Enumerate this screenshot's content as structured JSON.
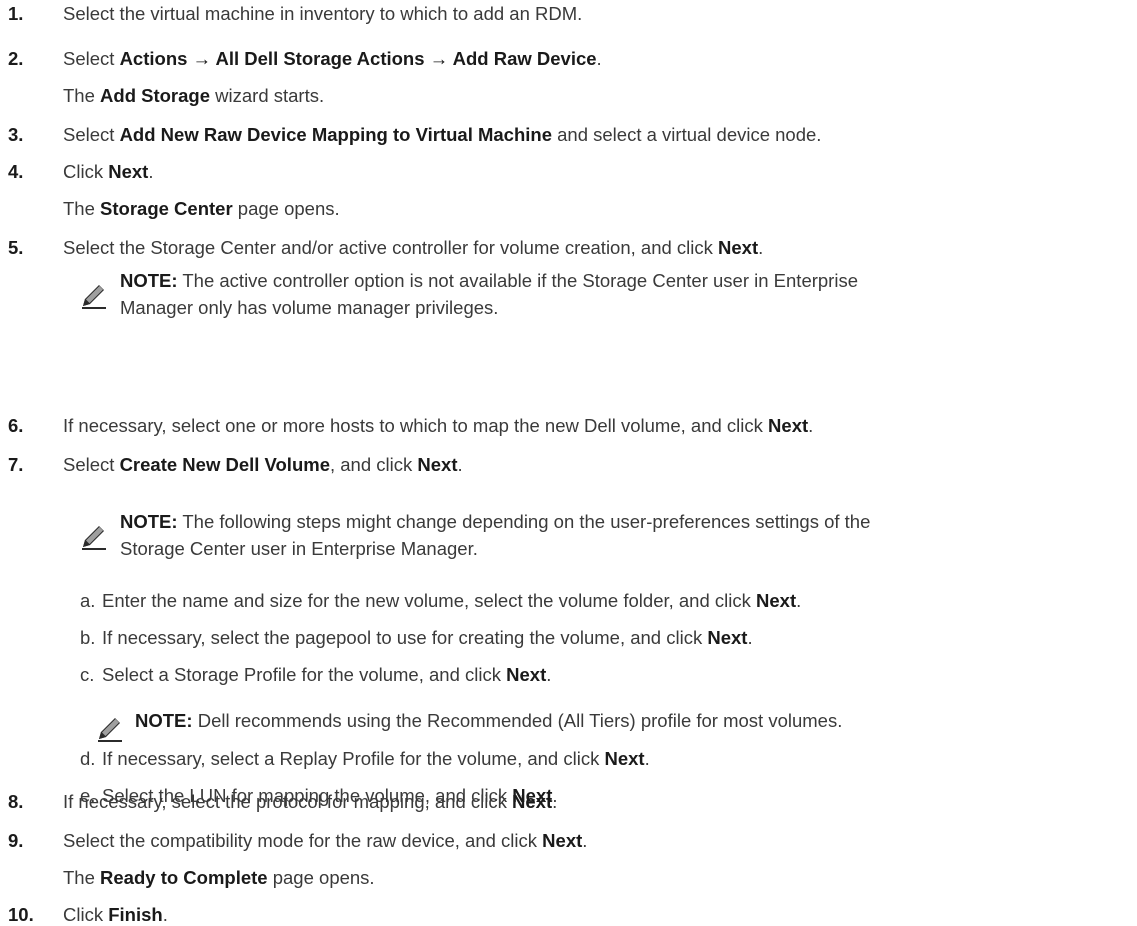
{
  "steps": [
    {
      "num": "1.",
      "segments": [
        {
          "t": "Select the virtual machine in inventory to which to add an RDM."
        }
      ]
    },
    {
      "num": "2.",
      "segments": [
        {
          "t": "Select "
        },
        {
          "t": "Actions → All Dell Storage Actions → Add Raw Device",
          "b": true
        },
        {
          "t": "."
        }
      ]
    },
    {
      "num": "",
      "segments": [
        {
          "t": "The "
        },
        {
          "t": "Add Storage",
          "b": true
        },
        {
          "t": " wizard starts."
        }
      ]
    },
    {
      "num": "3.",
      "segments": [
        {
          "t": "Select "
        },
        {
          "t": "Add New Raw Device Mapping to Virtual Machine",
          "b": true
        },
        {
          "t": " and select a virtual device node."
        }
      ]
    },
    {
      "num": "4.",
      "segments": [
        {
          "t": "Click "
        },
        {
          "t": "Next",
          "b": true
        },
        {
          "t": "."
        }
      ]
    },
    {
      "num": "",
      "segments": [
        {
          "t": "The "
        },
        {
          "t": "Storage Center",
          "b": true
        },
        {
          "t": " page opens."
        }
      ]
    },
    {
      "num": "5.",
      "segments": [
        {
          "t": "Select the Storage Center and/or active controller for volume creation, and click "
        },
        {
          "t": "Next",
          "b": true
        },
        {
          "t": "."
        }
      ]
    },
    {
      "num": "6.",
      "segments": [
        {
          "t": "If necessary, select one or more hosts to which to map the new Dell volume, and click "
        },
        {
          "t": "Next",
          "b": true
        },
        {
          "t": "."
        }
      ]
    },
    {
      "num": "7.",
      "segments": [
        {
          "t": "Select "
        },
        {
          "t": "Create New Dell Volume",
          "b": true
        },
        {
          "t": ", and click "
        },
        {
          "t": "Next",
          "b": true
        },
        {
          "t": "."
        }
      ]
    },
    {
      "num": "8.",
      "segments": [
        {
          "t": "If necessary, select the protocol for mapping, and click "
        },
        {
          "t": "Next",
          "b": true
        },
        {
          "t": "."
        }
      ]
    },
    {
      "num": "9.",
      "segments": [
        {
          "t": "Select the compatibility mode for the raw device, and click "
        },
        {
          "t": "Next",
          "b": true
        },
        {
          "t": "."
        }
      ]
    },
    {
      "num": "",
      "segments": [
        {
          "t": "The "
        },
        {
          "t": "Ready to Complete",
          "b": true
        },
        {
          "t": " page opens."
        }
      ]
    },
    {
      "num": "10.",
      "segments": [
        {
          "t": "Click "
        },
        {
          "t": "Finish",
          "b": true
        },
        {
          "t": "."
        }
      ]
    }
  ],
  "notes": [
    {
      "label": "NOTE:",
      "lines": [
        "The active controller option is not available if the Storage Center user in Enterprise",
        "Manager only has volume manager privileges."
      ],
      "icon": "note-pencil-icon"
    },
    {
      "label": "NOTE:",
      "lines": [
        "The following steps might change depending on the user-preferences settings of the",
        "Storage Center user in Enterprise Manager."
      ],
      "icon": "note-pencil-icon"
    },
    {
      "label": "NOTE:",
      "lines": [
        "Dell recommends using the Recommended (All Tiers) profile for most volumes."
      ],
      "icon": "note-pencil-icon"
    }
  ],
  "substeps": [
    {
      "letter": "a.",
      "segments": [
        {
          "t": "Enter the name and size for the new volume, select the volume folder, and click "
        },
        {
          "t": "Next",
          "b": true
        },
        {
          "t": "."
        }
      ]
    },
    {
      "letter": "b.",
      "segments": [
        {
          "t": "If necessary, select the pagepool to use for creating the volume, and click "
        },
        {
          "t": "Next",
          "b": true
        },
        {
          "t": "."
        }
      ]
    },
    {
      "letter": "c.",
      "segments": [
        {
          "t": "Select a Storage Profile for the volume, and click "
        },
        {
          "t": "Next",
          "b": true
        },
        {
          "t": "."
        }
      ]
    },
    {
      "letter": "d.",
      "segments": [
        {
          "t": "If necessary, select a Replay Profile for the volume, and click "
        },
        {
          "t": "Next",
          "b": true
        },
        {
          "t": "."
        }
      ]
    },
    {
      "letter": "e.",
      "segments": [
        {
          "t": "Select the LUN for mapping the volume, and click "
        },
        {
          "t": "Next",
          "b": true
        },
        {
          "t": "."
        }
      ]
    }
  ]
}
